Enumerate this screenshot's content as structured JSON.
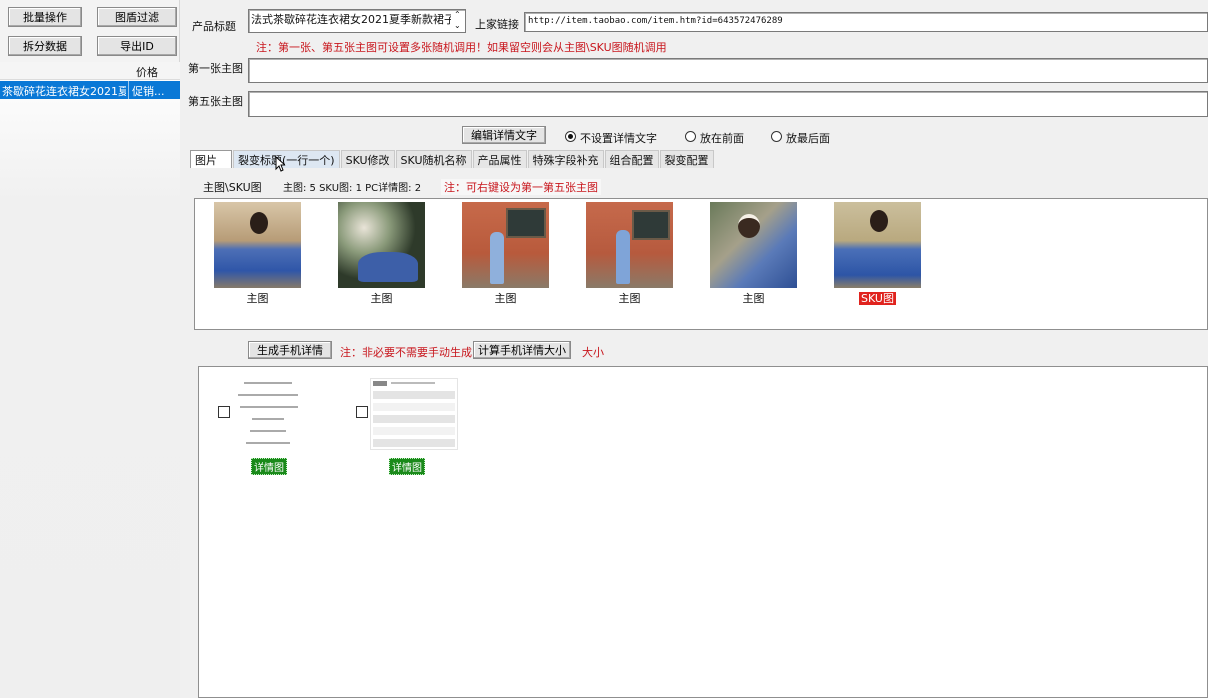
{
  "left": {
    "buttons": [
      "批量操作",
      "图盾过滤",
      "拆分数据",
      "导出ID"
    ],
    "col_price": "价格",
    "row_title": "茶歇碎花连衣裙女2021夏...",
    "row_price": "促销..."
  },
  "form": {
    "title_label": "产品标题",
    "title_value": "法式茶歇碎花连衣裙女2021夏季新款裙子夏",
    "link_label": "上家链接",
    "link_value": "http://item.taobao.com/item.htm?id=643572476289",
    "note": "注：第一张、第五张主图可设置多张随机调用！如果留空则会从主图\\SKU图随机调用",
    "first_label": "第一张主图",
    "fifth_label": "第五张主图"
  },
  "detail_text": {
    "button": "编辑详情文字",
    "opt_none": "不设置详情文字",
    "opt_front": "放在前面",
    "opt_back": "放最后面"
  },
  "tabs": [
    "图片",
    "裂变标题(一行一个)",
    "SKU修改",
    "SKU随机名称",
    "产品属性",
    "特殊字段补充",
    "组合配置",
    "裂变配置"
  ],
  "info": {
    "label": "主图\\SKU图",
    "counts": "主图: 5  SKU图: 1  PC详情图: 2",
    "hint": "注：可右键设为第一第五张主图"
  },
  "thumbs": [
    {
      "caption": "主图",
      "sku": false
    },
    {
      "caption": "主图",
      "sku": false
    },
    {
      "caption": "主图",
      "sku": false
    },
    {
      "caption": "主图",
      "sku": false
    },
    {
      "caption": "主图",
      "sku": false
    },
    {
      "caption": "SKU图",
      "sku": true
    }
  ],
  "mobile": {
    "gen_button": "生成手机详情",
    "gen_note": "注：非必要不需要手动生成",
    "calc_button": "计算手机详情大小",
    "size_label": "大小"
  },
  "details": [
    {
      "tag": "详情图"
    },
    {
      "tag": "详情图"
    }
  ]
}
